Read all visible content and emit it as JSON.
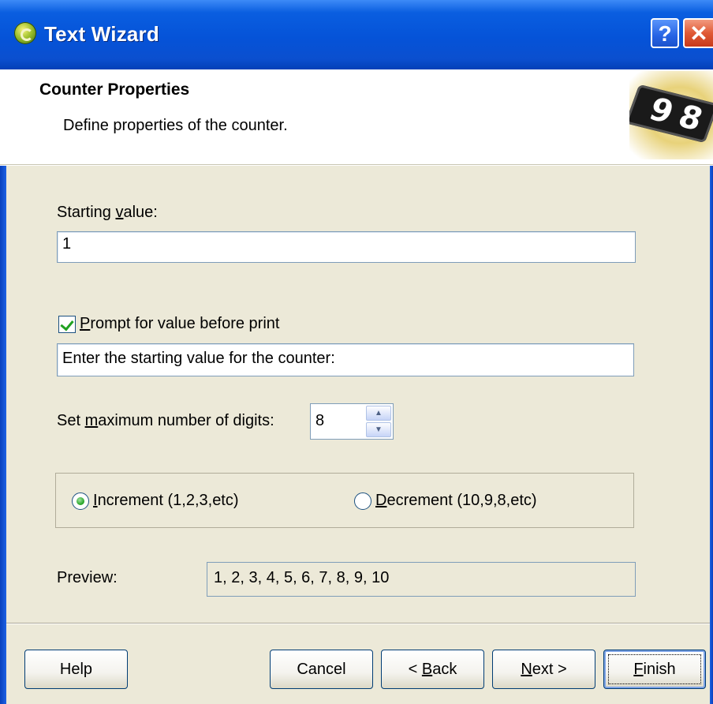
{
  "window": {
    "title": "Text Wizard",
    "help_glyph": "?",
    "close_glyph": "✕"
  },
  "header": {
    "title": "Counter Properties",
    "subtitle": "Define properties of the counter.",
    "graphic_digits": "98"
  },
  "form": {
    "starting_value": {
      "label_pre": "Starting ",
      "label_accel": "v",
      "label_post": "alue:",
      "value": "1"
    },
    "prompt": {
      "checked": true,
      "label_accel": "P",
      "label_post": "rompt for value before print",
      "value": "Enter the starting value for the counter:"
    },
    "max_digits": {
      "label_pre": "Set ",
      "label_accel": "m",
      "label_post": "aximum number of digits:",
      "value": "8"
    },
    "direction": {
      "increment": {
        "accel": "I",
        "label": "ncrement  (1,2,3,etc)",
        "selected": true
      },
      "decrement": {
        "accel": "D",
        "label": "ecrement  (10,9,8,etc)",
        "selected": false
      }
    },
    "preview": {
      "label": "Preview:",
      "value": "1, 2, 3, 4, 5, 6, 7, 8, 9, 10"
    }
  },
  "buttons": {
    "help": "Help",
    "cancel": "Cancel",
    "back_pre": "< ",
    "back_accel": "B",
    "back_post": "ack",
    "next_accel": "N",
    "next_post": "ext >",
    "finish_accel": "F",
    "finish_post": "inish"
  },
  "colors": {
    "titlebar": "#0553d8",
    "dialog_bg": "#ece9d8",
    "check_green": "#21a121"
  },
  "icons": [
    "app-icon",
    "help-icon",
    "close-icon",
    "counter-graphic",
    "spin-up-icon",
    "spin-down-icon"
  ]
}
